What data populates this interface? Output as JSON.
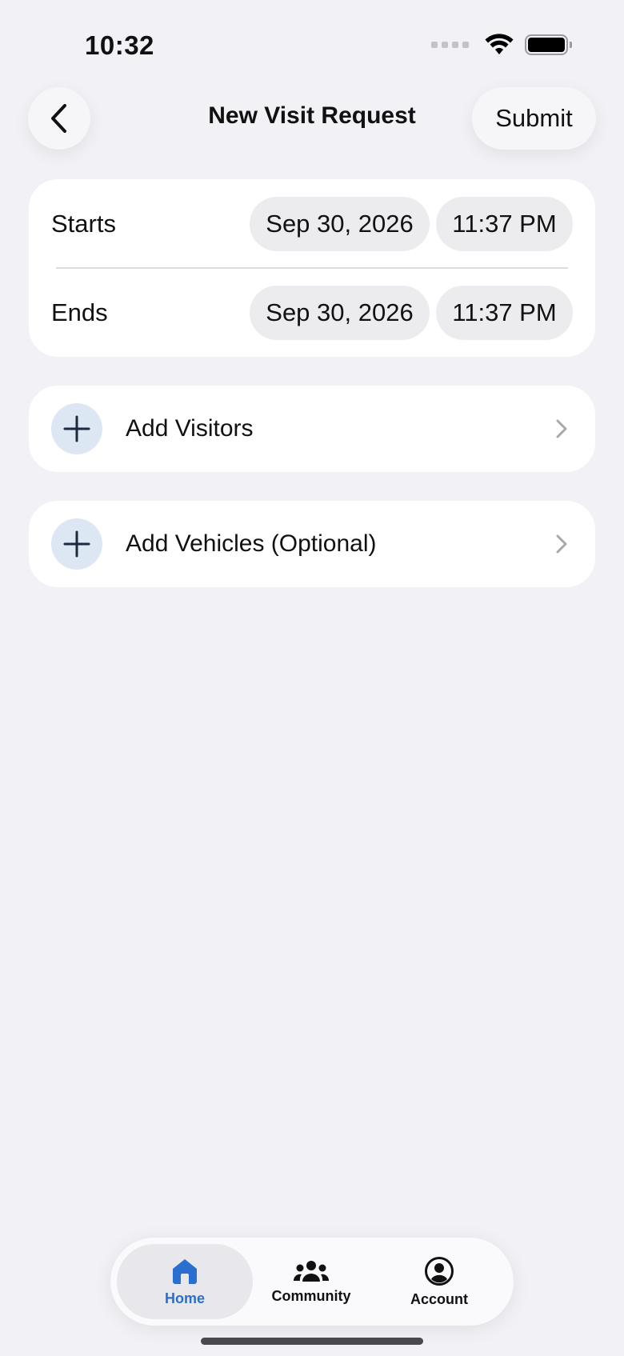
{
  "status_bar": {
    "time": "10:32"
  },
  "nav": {
    "title": "New Visit Request",
    "submit_label": "Submit"
  },
  "schedule": {
    "starts": {
      "label": "Starts",
      "date": "Sep 30, 2026",
      "time": "11:37 PM"
    },
    "ends": {
      "label": "Ends",
      "date": "Sep 30, 2026",
      "time": "11:37 PM"
    }
  },
  "actions": {
    "add_visitors": "Add Visitors",
    "add_vehicles": "Add Vehicles (Optional)"
  },
  "tab_bar": {
    "tabs": [
      {
        "label": "Home",
        "icon": "home-icon",
        "selected": true
      },
      {
        "label": "Community",
        "icon": "community-icon",
        "selected": false
      },
      {
        "label": "Account",
        "icon": "account-icon",
        "selected": false
      }
    ]
  },
  "colors": {
    "accent": "#2a6fd0",
    "background": "#f1f1f6",
    "plus_bg": "#dde7f4"
  }
}
